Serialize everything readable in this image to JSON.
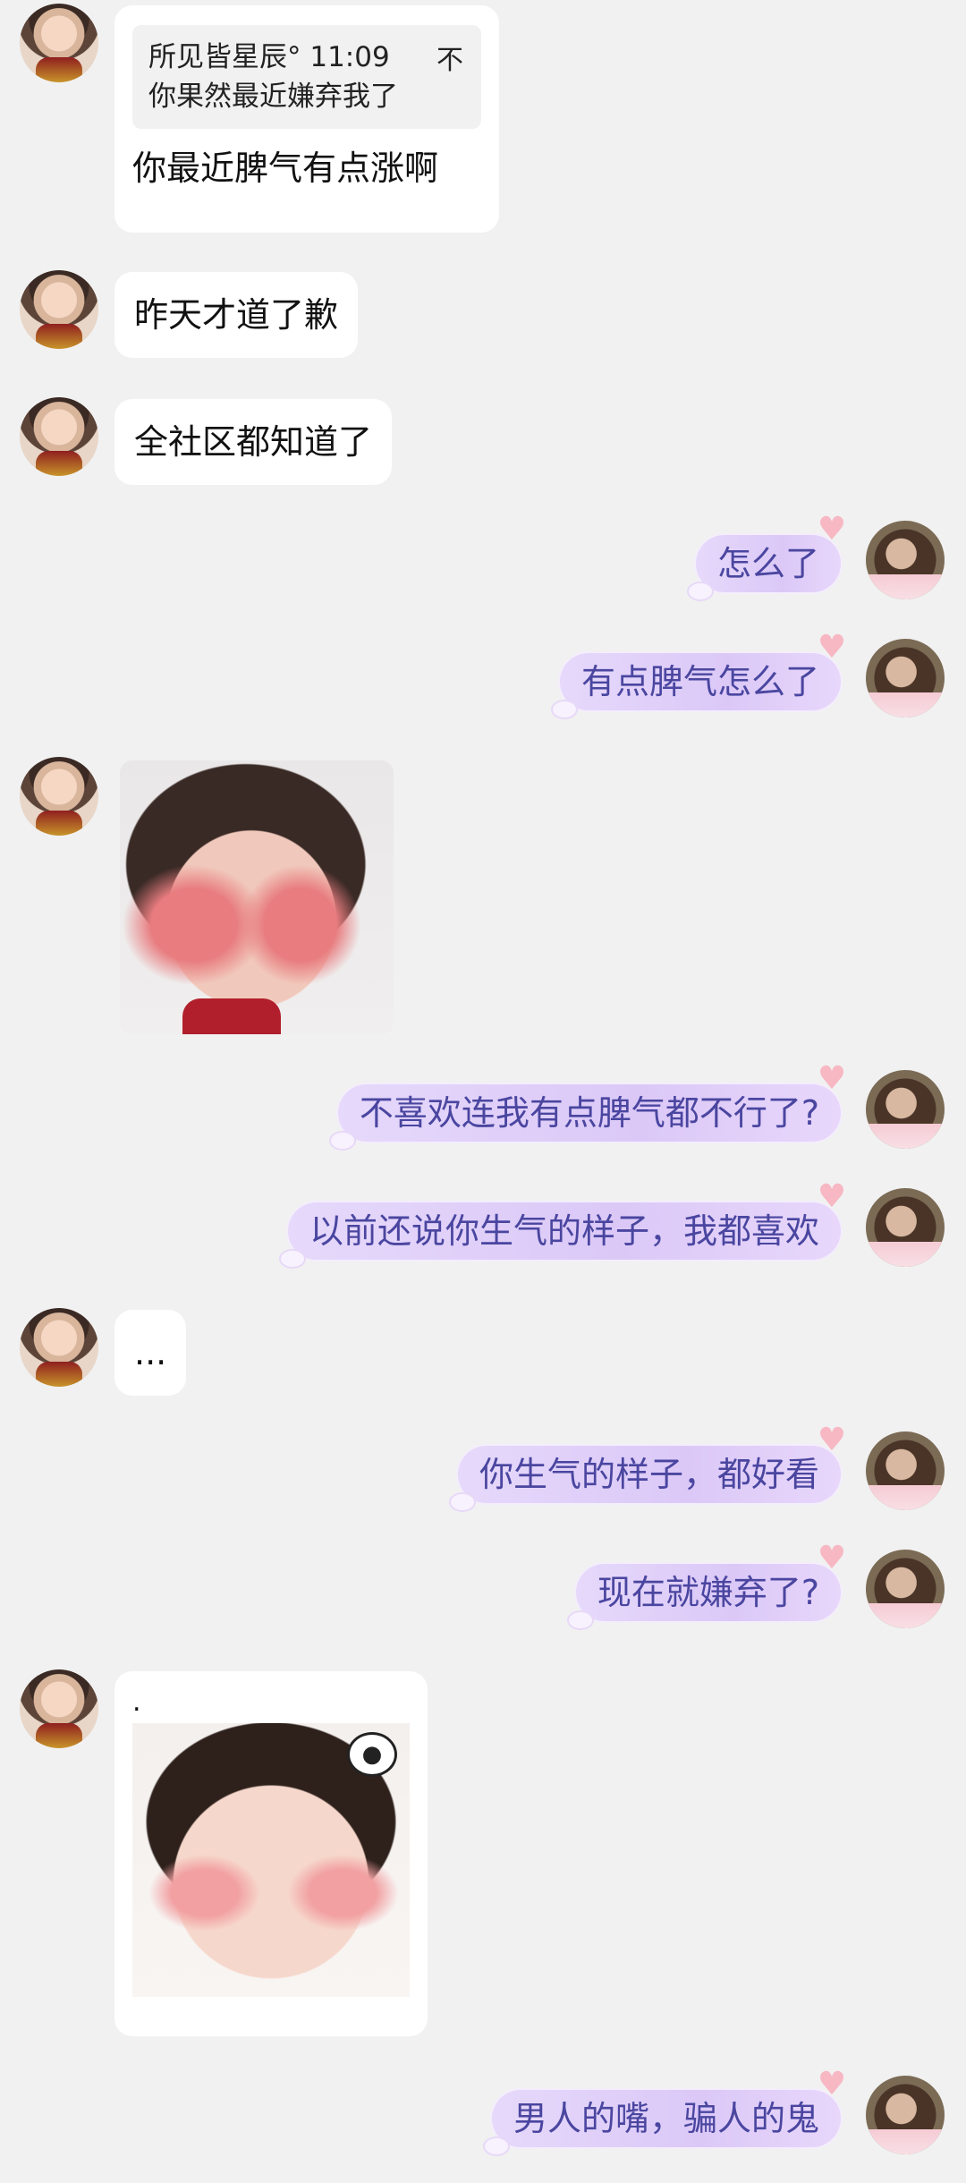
{
  "quote": {
    "header": "所见皆星辰° 11:09",
    "text": "你果然最近嫌弃我了",
    "more_icon": "不"
  },
  "messages": [
    {
      "side": "left",
      "text": "你最近脾气有点涨啊"
    },
    {
      "side": "left",
      "text": "昨天才道了歉"
    },
    {
      "side": "left",
      "text": "全社区都知道了"
    },
    {
      "side": "right",
      "text": "怎么了"
    },
    {
      "side": "right",
      "text": "有点脾气怎么了"
    },
    {
      "side": "left",
      "type": "image",
      "icon": "girl-pouting-sticker"
    },
    {
      "side": "right",
      "text": "不喜欢连我有点脾气都不行了?"
    },
    {
      "side": "right",
      "text": "以前还说你生气的样子，我都喜欢"
    },
    {
      "side": "left",
      "text": "..."
    },
    {
      "side": "right",
      "text": "你生气的样子，都好看"
    },
    {
      "side": "right",
      "text": "现在就嫌弃了?"
    },
    {
      "side": "left",
      "caption": ".",
      "type": "image",
      "icon": "girl-sticker-with-thought"
    },
    {
      "side": "right",
      "text": "男人的嘴，骗人的鬼"
    }
  ],
  "colors": {
    "background": "#f1f1f1",
    "left_bubble": "#ffffff",
    "right_bubble": "#dbc8f7",
    "right_text": "#4a46a0"
  }
}
